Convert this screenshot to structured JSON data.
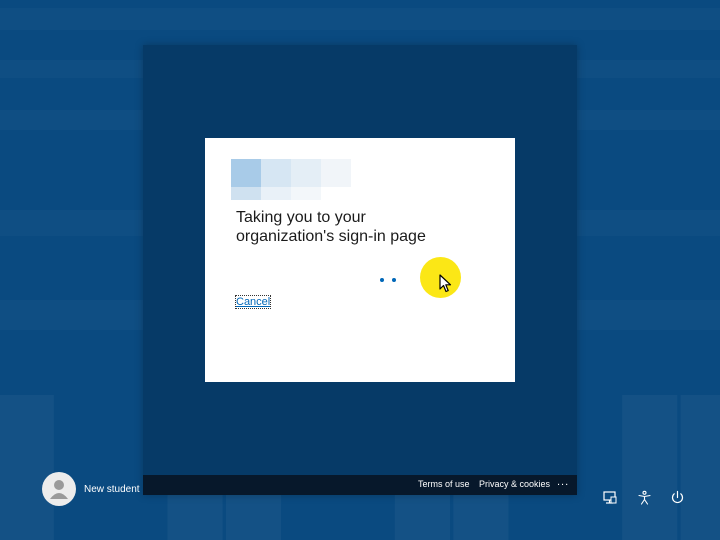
{
  "dialog": {
    "title_line1": "Taking you to your",
    "title_line2": "organization's sign-in page",
    "cancel_label": "Cancel"
  },
  "user": {
    "name": "New student"
  },
  "footer": {
    "terms_label": "Terms of use",
    "privacy_label": "Privacy & cookies",
    "more_label": "..."
  },
  "system_icons": [
    {
      "name": "network-icon"
    },
    {
      "name": "accessibility-icon"
    },
    {
      "name": "power-icon"
    }
  ],
  "colors": {
    "background": "#0a4a80",
    "panel": "#063a67",
    "footer_bar": "#07182b",
    "accent": "#0067b8",
    "cursor_highlight": "#fbe716"
  }
}
